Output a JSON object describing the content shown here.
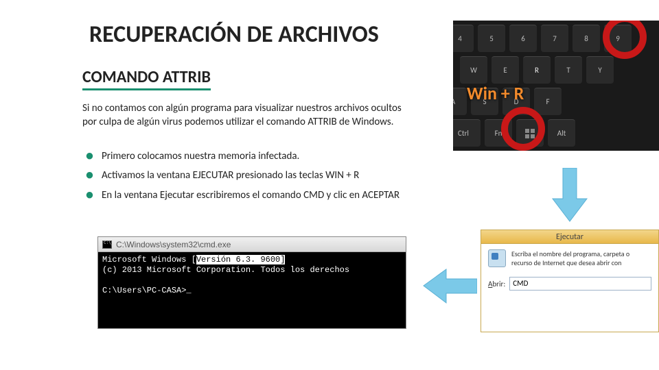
{
  "title": "RECUPERACIÓN DE ARCHIVOS",
  "subtitle": "COMANDO ATTRIB",
  "intro": "Si no contamos con algún programa para visualizar nuestros archivos ocultos por culpa de algún virus podemos utilizar el comando ATTRIB de Windows.",
  "bullets": [
    "Primero colocamos nuestra memoria infectada.",
    "Activamos la ventana EJECUTAR presionado las teclas WIN + R",
    "En la ventana Ejecutar escribiremos el comando CMD y clic en ACEPTAR"
  ],
  "keyboard": {
    "shortcut_text": "Win + R",
    "key_r": "R"
  },
  "run_dialog": {
    "title": "Ejecutar",
    "description": "Escriba el nombre del programa, carpeta o recurso de Internet que desea abrir con",
    "open_label_prefix": "A",
    "open_label_rest": "brir:",
    "input_value": "CMD"
  },
  "cmd_window": {
    "titlebar": "C:\\Windows\\system32\\cmd.exe",
    "line1_a": "Microsoft Windows [",
    "line1_b": "Versión 6.3. 9600]",
    "line2": "(c) 2013 Microsoft Corporation. Todos los derechos",
    "prompt": "C:\\Users\\PC-CASA>",
    "cursor": "_"
  }
}
